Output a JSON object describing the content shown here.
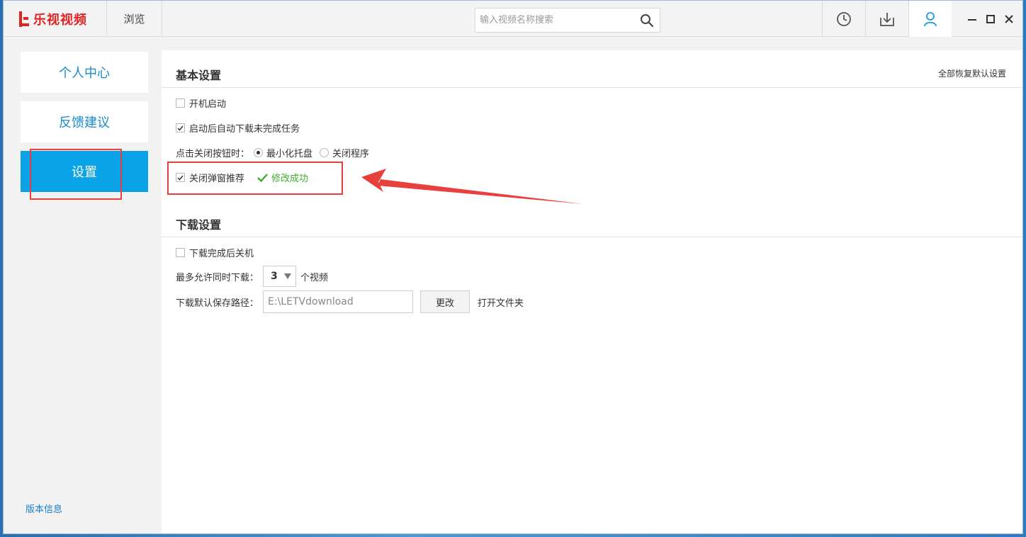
{
  "app": {
    "logo_text": "乐视视频",
    "brand_color": "#e02424"
  },
  "topnav": {
    "browse_label": "浏览"
  },
  "search": {
    "placeholder": "输入视频名称搜索",
    "icon": "search-icon"
  },
  "toolbar": {
    "icons": [
      "history-icon",
      "download-icon",
      "user-icon"
    ],
    "active": "user-icon"
  },
  "window_controls": [
    "minimize-icon",
    "maximize-icon",
    "close-icon"
  ],
  "sidebar": {
    "items": [
      {
        "label": "个人中心",
        "active": false
      },
      {
        "label": "反馈建议",
        "active": false
      },
      {
        "label": "设置",
        "active": true
      }
    ],
    "version_link": "版本信息",
    "accent_color": "#0aa3e8"
  },
  "basic_settings": {
    "title": "基本设置",
    "reset_all": "全部恢复默认设置",
    "autostart": {
      "label": "开机启动",
      "checked": false
    },
    "auto_resume": {
      "label": "启动后自动下载未完成任务",
      "checked": true
    },
    "close_action": {
      "label": "点击关闭按钮时：",
      "options": [
        "最小化托盘",
        "关闭程序"
      ],
      "selected": "最小化托盘"
    },
    "close_popup": {
      "label": "关闭弹窗推荐",
      "checked": true
    },
    "success_message": "修改成功"
  },
  "download_settings": {
    "title": "下载设置",
    "shutdown_after": {
      "label": "下载完成后关机",
      "checked": false
    },
    "max_concurrent": {
      "label": "最多允许同时下载：",
      "value": "3",
      "suffix": "个视频"
    },
    "save_path": {
      "label": "下载默认保存路径：",
      "value": "E:\\LETVdownload"
    },
    "change_button": "更改",
    "open_folder": "打开文件夹"
  },
  "annotation": {
    "color": "#e8403f"
  }
}
